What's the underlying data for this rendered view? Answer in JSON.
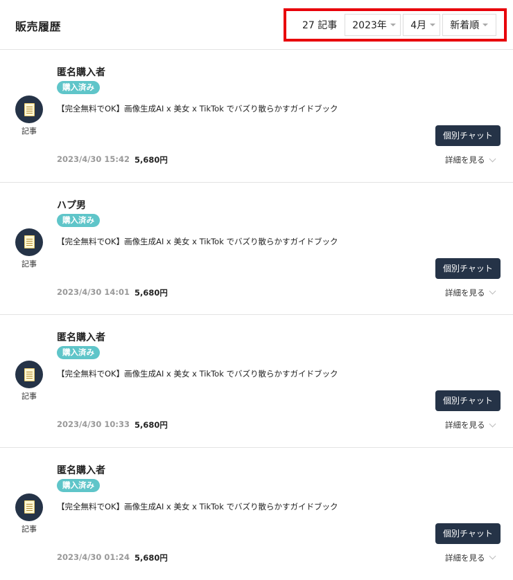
{
  "header": {
    "title": "販売履歴",
    "count": "27 記事",
    "year": "2023年",
    "month": "4月",
    "sort": "新着順"
  },
  "items": [
    {
      "buyer": "匿名購入者",
      "status": "購入済み",
      "title": "【完全無料でOK】画像生成AI x 美女 x TikTok でバズり散らかすガイドブック",
      "kind": "記事",
      "date": "2023/4/30 15:42",
      "price": "5,680円",
      "chat": "個別チャット",
      "details": "詳細を見る"
    },
    {
      "buyer": "ハプ男",
      "status": "購入済み",
      "title": "【完全無料でOK】画像生成AI x 美女 x TikTok でバズり散らかすガイドブック",
      "kind": "記事",
      "date": "2023/4/30 14:01",
      "price": "5,680円",
      "chat": "個別チャット",
      "details": "詳細を見る"
    },
    {
      "buyer": "匿名購入者",
      "status": "購入済み",
      "title": "【完全無料でOK】画像生成AI x 美女 x TikTok でバズり散らかすガイドブック",
      "kind": "記事",
      "date": "2023/4/30 10:33",
      "price": "5,680円",
      "chat": "個別チャット",
      "details": "詳細を見る"
    },
    {
      "buyer": "匿名購入者",
      "status": "購入済み",
      "title": "【完全無料でOK】画像生成AI x 美女 x TikTok でバズり散らかすガイドブック",
      "kind": "記事",
      "date": "2023/4/30 01:24",
      "price": "5,680円",
      "chat": "個別チャット",
      "details": "詳細を見る"
    }
  ],
  "colors": {
    "navy": "#253347",
    "badge": "#5fc5c9",
    "highlight": "#e8000a"
  },
  "icons": {
    "article": "document-icon",
    "dropdown": "caret-down-icon",
    "expand": "chevron-down-icon"
  }
}
